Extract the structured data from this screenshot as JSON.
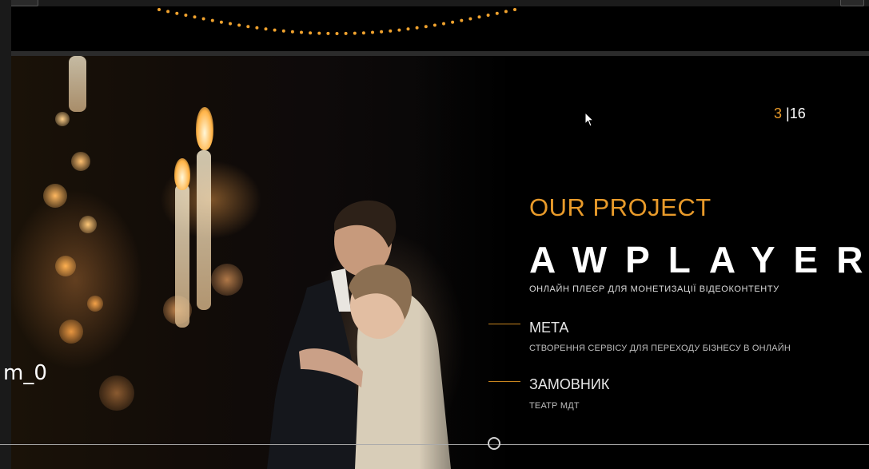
{
  "slide": {
    "counter_current": "3",
    "counter_separator": "|",
    "counter_total": "16",
    "subtitle": "OUR PROJECT",
    "brand": "AWPLAYER",
    "tagline": "ОНЛАЙН ПЛЕЄР ДЛЯ МОНЕТИЗАЦІЇ ВІДЕОКОНТЕНТУ",
    "sections": [
      {
        "title": "МЕТА",
        "text": "СТВОРЕННЯ СЕРВІСУ ДЛЯ ПЕРЕХОДУ БІЗНЕСУ В ОНЛАЙН"
      },
      {
        "title": "ЗАМОВНИК",
        "text": "ТЕАТР МДТ"
      }
    ]
  },
  "overlay": {
    "label": "m_0"
  },
  "colors": {
    "accent": "#e89a2a",
    "background": "#000000",
    "text": "#ffffff"
  },
  "icons": {
    "cursor": "mouse-pointer-icon",
    "timeline_knob": "playhead-icon"
  }
}
